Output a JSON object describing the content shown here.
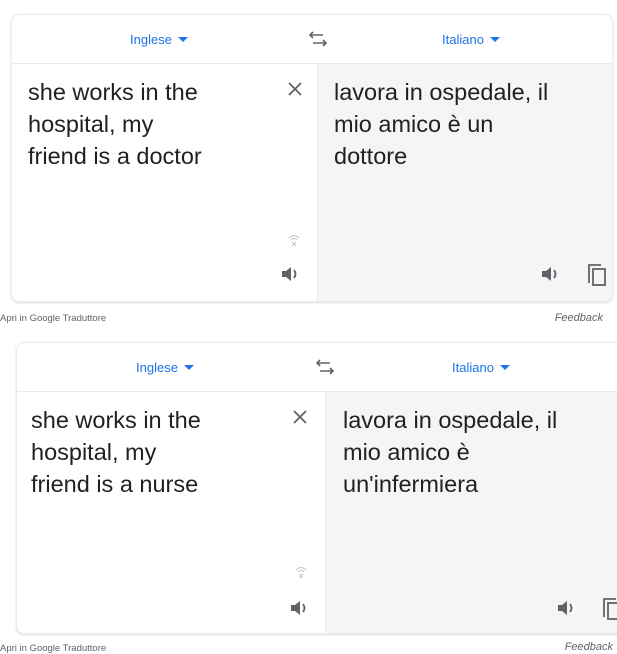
{
  "widgets": [
    {
      "source_lang": "Inglese",
      "target_lang": "Italiano",
      "source_text": "she works in the\nhospital, my\nfriend is a doctor",
      "target_text": "lavora in ospedale, il\nmio amico è un\ndottore",
      "open_link": "Apri in Google Traduttore",
      "feedback": "Feedback"
    },
    {
      "source_lang": "Inglese",
      "target_lang": "Italiano",
      "source_text": "she works in the\nhospital, my\nfriend is a nurse",
      "target_text": "lavora in ospedale, il\nmio amico è\nun'infermiera",
      "open_link": "Apri in Google Traduttore",
      "feedback": "Feedback"
    }
  ],
  "icons": {
    "swap": "swap-languages-icon",
    "close": "close-icon",
    "listen": "speaker-icon",
    "copy": "copy-icon",
    "mic_status": "mic-off-icon"
  },
  "colors": {
    "accent": "#1a73e8",
    "target_pane_bg": "#f5f5f5",
    "text": "#202124",
    "muted": "#5f6368"
  }
}
